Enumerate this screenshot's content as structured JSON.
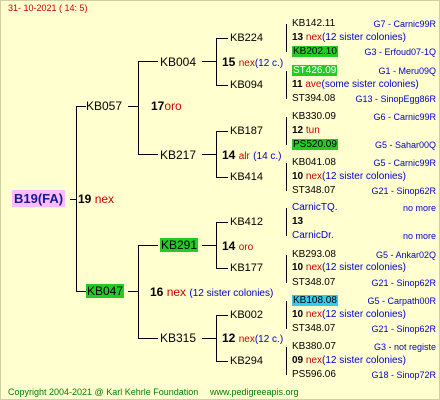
{
  "header": {
    "date": "31- 10-2021 ( 14: 5)"
  },
  "root": {
    "name": "B19(FA)",
    "num": "19",
    "suffix": "nex"
  },
  "gen1": [
    {
      "name": "KB057",
      "num": "17",
      "suffix": "oro"
    },
    {
      "name": "KB047",
      "num": "16",
      "suffix": "nex",
      "note": "(12 sister colonies)"
    }
  ],
  "gen2": [
    {
      "name": "KB004",
      "num": "15",
      "suffix": "nex",
      "note": "(12 c.)"
    },
    {
      "name": "KB217",
      "num": "14",
      "suffix": "alr",
      "note": "(14 c.)"
    },
    {
      "name": "KB291",
      "num": "14",
      "suffix": "oro"
    },
    {
      "name": "KB315",
      "num": "12",
      "suffix": "nex",
      "note": "(12 c.)"
    }
  ],
  "gen3": [
    {
      "name": "KB224",
      "num": "13",
      "suffix": "nex",
      "note": "(12 sister colonies)"
    },
    {
      "name": "KB094",
      "num": "11",
      "suffix": "ave",
      "note": "(some sister colonies)"
    },
    {
      "name": "KB187",
      "num": "12",
      "suffix": "tun"
    },
    {
      "name": "KB414",
      "num": "10",
      "suffix": "nex",
      "note": "(12 sister colonies)"
    },
    {
      "name": "KB412",
      "num": "13",
      "suffix": ""
    },
    {
      "name": "KB177",
      "num": "10",
      "suffix": "nex",
      "note": "(12 sister colonies)"
    },
    {
      "name": "KB002",
      "num": "10",
      "suffix": "nex",
      "note": "(12 sister colonies)"
    },
    {
      "name": "KB294",
      "num": "09",
      "suffix": "nex",
      "note": "(12 sister colonies)"
    }
  ],
  "gen4": [
    {
      "name": "KB142.11",
      "ref": "G7 - Carnic99R"
    },
    {
      "name": "KB202.10",
      "ref": "G3 - Erfoud07-1Q"
    },
    {
      "name": "ST426.09",
      "ref": "G1 - Meru09Q"
    },
    {
      "name": "ST394.08",
      "ref": "G13 - SinopEgg86R"
    },
    {
      "name": "KB330.09",
      "ref": "G6 - Carnic99R"
    },
    {
      "name": "PS520.09",
      "ref": "G5 - Sahar00Q"
    },
    {
      "name": "KB041.08",
      "ref": "G5 - Carnic99R"
    },
    {
      "name": "ST348.07",
      "ref": "G21 - Sinop62R"
    },
    {
      "name": "CarnicTQ.",
      "ref": "no more"
    },
    {
      "name": "CarnicDr.",
      "ref": "no more"
    },
    {
      "name": "KB293.08",
      "ref": "G5 - Ankar02Q"
    },
    {
      "name": "ST348.07",
      "ref": "G21 - Sinop62R"
    },
    {
      "name": "KB108.08",
      "ref": "G5 - Carpath00R"
    },
    {
      "name": "ST348.07",
      "ref": "G21 - Sinop62R"
    },
    {
      "name": "KB380.07",
      "ref": "G3 - not registe"
    },
    {
      "name": "PS596.06",
      "ref": "G18 - Sinop72R"
    }
  ],
  "footer": {
    "copyright": "Copyright 2004-2021 @ Karl Kehrle Foundation",
    "url": "www.pedigreeapis.org"
  },
  "colors": {
    "background": "#ffffd0",
    "highlight_green": "#22cc22",
    "highlight_cyan": "#33ccee",
    "root_bg": "#ffbbff"
  }
}
